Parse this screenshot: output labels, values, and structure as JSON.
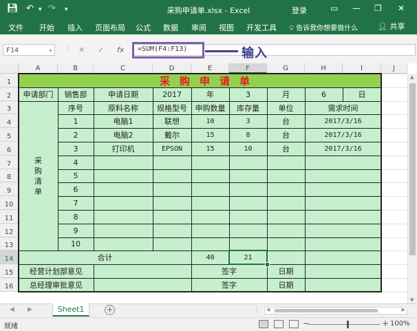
{
  "app": {
    "file_title": "采购申请单.xlsx - Excel",
    "login": "登录",
    "tabs": [
      "文件",
      "开始",
      "插入",
      "页面布局",
      "公式",
      "数据",
      "审阅",
      "视图",
      "开发工具"
    ],
    "tell_me": "告诉我你想要做什么",
    "share": "共享",
    "icons": [
      "save-icon",
      "undo-icon",
      "redo-icon",
      "customize-icon",
      "ribbon-display-icon",
      "minimize-icon",
      "restore-icon",
      "close-icon",
      "lightbulb-icon",
      "user-icon"
    ]
  },
  "formula_bar": {
    "name_box": "F14",
    "formula": "=SUM(F4:F13)",
    "annotation": "输入",
    "fx": "fx",
    "cancel": "✕",
    "enter": "✓"
  },
  "columns": [
    "A",
    "B",
    "C",
    "D",
    "E",
    "F",
    "G",
    "H",
    "I",
    "J"
  ],
  "rows": [
    "1",
    "2",
    "3",
    "4",
    "5",
    "6",
    "7",
    "8",
    "9",
    "10",
    "11",
    "12",
    "13",
    "14",
    "15",
    "16"
  ],
  "selected": {
    "column": "F",
    "row": "14"
  },
  "table": {
    "title": "采购申请单",
    "row2": {
      "dept_label": "申请部门",
      "dept": "销售部",
      "date_label": "申请日期",
      "year": "2017",
      "year_unit": "年",
      "month": "3",
      "month_unit": "月",
      "day": "6",
      "day_unit": "日"
    },
    "headers": {
      "seq": "序号",
      "name": "原料名称",
      "model": "规格型号",
      "qty": "申购数量",
      "stock": "库存量",
      "unit": "单位",
      "need_time": "需求时间"
    },
    "side_label": [
      "采",
      "购",
      "清",
      "单"
    ],
    "items": [
      {
        "seq": "1",
        "name": "电脑1",
        "model": "联想",
        "qty": "10",
        "stock": "3",
        "unit": "台",
        "date": "2017/3/16"
      },
      {
        "seq": "2",
        "name": "电脑2",
        "model": "戴尔",
        "qty": "15",
        "stock": "8",
        "unit": "台",
        "date": "2017/3/16"
      },
      {
        "seq": "3",
        "name": "打印机",
        "model": "EPSON",
        "qty": "15",
        "stock": "10",
        "unit": "台",
        "date": "2017/3/16"
      },
      {
        "seq": "4"
      },
      {
        "seq": "5"
      },
      {
        "seq": "6"
      },
      {
        "seq": "7"
      },
      {
        "seq": "8"
      },
      {
        "seq": "9"
      },
      {
        "seq": "10"
      }
    ],
    "total": {
      "label": "合计",
      "qty": "40",
      "stock": "21"
    },
    "row15": {
      "label": "经营计划部意见",
      "sign": "签字",
      "date": "日期"
    },
    "row16": {
      "label": "总经理审批意见",
      "sign": "签字",
      "date": "日期"
    }
  },
  "sheet_tabs": {
    "active": "Sheet1",
    "add": "+"
  },
  "status": {
    "ready": "就绪",
    "zoom": "100%",
    "zoom_minus": "−",
    "zoom_plus": "+"
  }
}
